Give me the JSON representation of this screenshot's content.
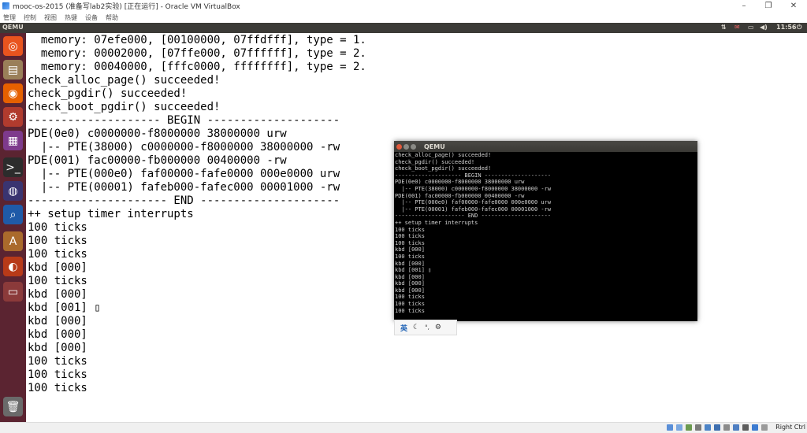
{
  "window": {
    "title": "mooc-os-2015 (准备写lab2实验) [正在运行] - Oracle VM VirtualBox",
    "menu": [
      "管理",
      "控制",
      "视图",
      "热键",
      "设备",
      "帮助"
    ],
    "controls": {
      "minimize": "–",
      "maximize": "❐",
      "close": "✕"
    }
  },
  "panel": {
    "title": "QEMU",
    "clock": "11:56",
    "indicators": [
      "⇅",
      "✉",
      "▭",
      "◀)",
      "⏻"
    ]
  },
  "launcher": {
    "items": [
      {
        "name": "dash",
        "glyph": "◎",
        "color": "#e9541e"
      },
      {
        "name": "files",
        "glyph": "▤",
        "color": "#9a7f59"
      },
      {
        "name": "firefox",
        "glyph": "◉",
        "color": "#e66000"
      },
      {
        "name": "settings",
        "glyph": "⚙",
        "color": "#b13b2e"
      },
      {
        "name": "workspaces",
        "glyph": "▦",
        "color": "#7e3a8c"
      },
      {
        "name": "terminal",
        "glyph": ">_",
        "color": "#2c2c2c"
      },
      {
        "name": "eclipse",
        "glyph": "◍",
        "color": "#3a3470"
      },
      {
        "name": "search",
        "glyph": "⌕",
        "color": "#1f5aa8"
      },
      {
        "name": "software-updater",
        "glyph": "A",
        "color": "#aa6a2c"
      },
      {
        "name": "ubuntu-one",
        "glyph": "◐",
        "color": "#b83a18"
      },
      {
        "name": "app",
        "glyph": "▭",
        "color": "#8b3a3a"
      },
      {
        "name": "trash",
        "glyph": "🗑",
        "color": "#6a6a6a"
      }
    ]
  },
  "console": {
    "lines": [
      "  memory: 07efe000, [00100000, 07ffdfff], type = 1.",
      "  memory: 00002000, [07ffe000, 07ffffff], type = 2.",
      "  memory: 00040000, [fffc0000, ffffffff], type = 2.",
      "check_alloc_page() succeeded!",
      "check_pgdir() succeeded!",
      "check_boot_pgdir() succeeded!",
      "-------------------- BEGIN --------------------",
      "PDE(0e0) c0000000-f8000000 38000000 urw",
      "  |-- PTE(38000) c0000000-f8000000 38000000 -rw",
      "PDE(001) fac00000-fb000000 00400000 -rw",
      "  |-- PTE(000e0) faf00000-fafe0000 000e0000 urw",
      "  |-- PTE(00001) fafeb000-fafec000 00001000 -rw",
      "--------------------- END ---------------------",
      "++ setup timer interrupts",
      "100 ticks",
      "100 ticks",
      "100 ticks",
      "kbd [000]",
      "100 ticks",
      "kbd [000]",
      "kbd [001] ▯",
      "kbd [000]",
      "kbd [000]",
      "kbd [000]",
      "100 ticks",
      "100 ticks",
      "100 ticks"
    ]
  },
  "qemu_window": {
    "title": "QEMU",
    "lines": [
      "check_alloc_page() succeeded!",
      "check_pgdir() succeeded!",
      "check_boot_pgdir() succeeded!",
      "-------------------- BEGIN --------------------",
      "PDE(0e0) c0000000-f8000000 38000000 urw",
      "  |-- PTE(38000) c0000000-f8000000 38000000 -rw",
      "PDE(001) fac00000-fb000000 00400000 -rw",
      "  |-- PTE(000e0) faf00000-fafe0000 000e0000 urw",
      "  |-- PTE(00001) fafeb000-fafec000 00001000 -rw",
      "--------------------- END ---------------------",
      "++ setup timer interrupts",
      "100 ticks",
      "100 ticks",
      "100 ticks",
      "kbd [000]",
      "100 ticks",
      "kbd [000]",
      "kbd [001] ▯",
      "kbd [000]",
      "kbd [000]",
      "kbd [000]",
      "100 ticks",
      "100 ticks",
      "100 ticks"
    ]
  },
  "ime": {
    "lang": "英",
    "moon": "☾",
    "punct": "°,",
    "gear": "⚙"
  },
  "statusbar": {
    "host_key": "Right Ctrl"
  }
}
